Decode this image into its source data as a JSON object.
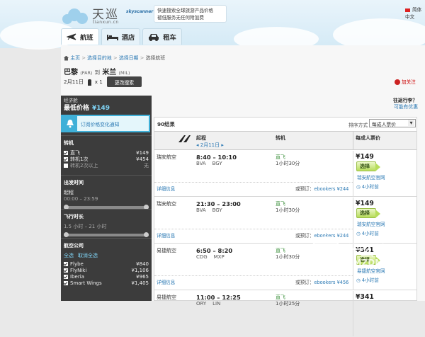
{
  "header": {
    "brand": "天巡",
    "skyscanner": "skyscanner 中国",
    "domain": "tianxun.cn",
    "bubble_line1": "快速搜索全球旅游产品价格",
    "bubble_line2": "褪低服务无任何附加费",
    "language": "简体中文"
  },
  "tabs": [
    {
      "label": "航班",
      "icon": "plane-icon"
    },
    {
      "label": "酒店",
      "icon": "bed-icon"
    },
    {
      "label": "租车",
      "icon": "car-icon"
    }
  ],
  "breadcrumb": {
    "home": "主页",
    "sep1": ">",
    "step1": "选择目的地",
    "sep2": ">",
    "step2": "选择日期",
    "sep3": ">",
    "current": "选择航班"
  },
  "route": {
    "from": "巴黎",
    "from_code": "(PAR)",
    "to_word": "到",
    "to": "米兰",
    "to_code": "(MIL)"
  },
  "search": {
    "date": "2月11日",
    "passengers": "x 1",
    "change_label": "更改搜索"
  },
  "follow_label": "加关注",
  "sidebar": {
    "cabin": "经济舱",
    "best_price_label": "最低价格",
    "best_price": "¥149",
    "alert_label": "订阅价格变化通知",
    "stops": {
      "title": "转机",
      "items": [
        {
          "label": "直飞",
          "price": "¥149",
          "checked": true
        },
        {
          "label": "转机1次",
          "price": "¥454",
          "checked": true
        },
        {
          "label": "转机2次以上",
          "price": "无",
          "checked": false
        }
      ]
    },
    "departure": {
      "title": "出发时间",
      "sub": "起程",
      "range": "00:00 – 23:59"
    },
    "duration": {
      "title": "飞行时长",
      "range": "1.5 小时 – 21 小时"
    },
    "airlines": {
      "title": "航空公司",
      "select_all": "全选",
      "clear_all": "取消全选",
      "items": [
        {
          "label": "Flybe",
          "price": "¥840"
        },
        {
          "label": "FlyNiki",
          "price": "¥1,106"
        },
        {
          "label": "Iberia",
          "price": "¥965"
        },
        {
          "label": "Smart Wings",
          "price": "¥1,405"
        }
      ]
    }
  },
  "trip": {
    "title": "往返行李？",
    "link": "可能有优惠"
  },
  "results": {
    "count": "90结果",
    "sort_label": "排序方式",
    "sort_value": "每成人票价",
    "header": {
      "depart": "起程",
      "date": "2月11日",
      "transfer": "转机",
      "price": "每成人票价"
    },
    "flights": [
      {
        "airline": "瑞安航空",
        "time": "8:40 – 10:10",
        "airports": "BVA    BGY",
        "stops": "直飞",
        "duration": "1小时30分",
        "price": "¥149",
        "select": "选择",
        "seller": "瑞安航空官网",
        "ago": "4小时前",
        "details": "详细信息",
        "or_book": "或预订：",
        "alt": "ebookers ¥244"
      },
      {
        "airline": "瑞安航空",
        "time": "21:30 – 23:00",
        "airports": "BVA    BGY",
        "stops": "直飞",
        "duration": "1小时30分",
        "price": "¥149",
        "select": "选择",
        "seller": "瑞安航空官网",
        "ago": "4小时前",
        "details": "详细信息",
        "or_book": "或预订：",
        "alt": "ebookers ¥244"
      },
      {
        "airline": "易捷航空",
        "time": "6:50 – 8:20",
        "airports": "CDG    MXP",
        "stops": "直飞",
        "duration": "1小时30分",
        "price": "¥341",
        "select": "选择",
        "seller": "易捷航空官网",
        "ago": "4小时前",
        "details": "详细信息",
        "or_book": "或预订：",
        "alt": "ebookers ¥456"
      },
      {
        "airline": "易捷航空",
        "time": "11:00 – 12:25",
        "airports": "ORY    LIN",
        "stops": "直飞",
        "duration": "1小时25分",
        "price": "¥341",
        "select": "选择",
        "seller": "",
        "ago": "",
        "details": "",
        "or_book": "",
        "alt": ""
      }
    ]
  },
  "watermark": {
    "line1": "什么值得买",
    "line2": "SMZDM.COM"
  }
}
